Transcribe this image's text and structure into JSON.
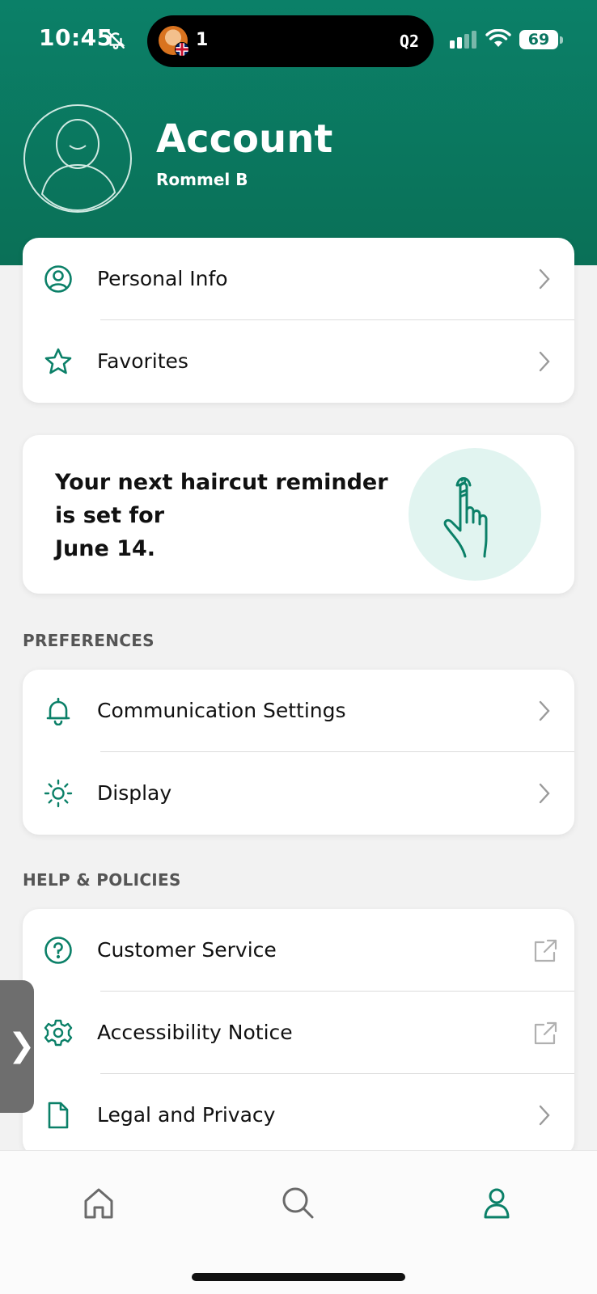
{
  "status_bar": {
    "time": "10:45",
    "island_count": "1",
    "island_right": "Q2",
    "battery": "69"
  },
  "header": {
    "title": "Account",
    "user_name": "Rommel B"
  },
  "account_menu": [
    {
      "label": "Personal Info",
      "icon": "user-circle-icon"
    },
    {
      "label": "Favorites",
      "icon": "star-icon"
    }
  ],
  "reminder": {
    "line1": "Your next haircut reminder",
    "line2": "is set for",
    "line3": "June 14."
  },
  "preferences": {
    "title": "PREFERENCES",
    "items": [
      {
        "label": "Communication Settings",
        "icon": "bell-icon"
      },
      {
        "label": "Display",
        "icon": "sun-icon"
      }
    ]
  },
  "help": {
    "title": "HELP & POLICIES",
    "items": [
      {
        "label": "Customer Service",
        "icon": "question-circle-icon"
      },
      {
        "label": "Accessibility Notice",
        "icon": "gear-icon"
      },
      {
        "label": "Legal and Privacy",
        "icon": "document-icon"
      }
    ]
  },
  "side_tab_glyph": "❯",
  "colors": {
    "brand": "#0b8068",
    "accent_light": "#e1f4f0"
  }
}
